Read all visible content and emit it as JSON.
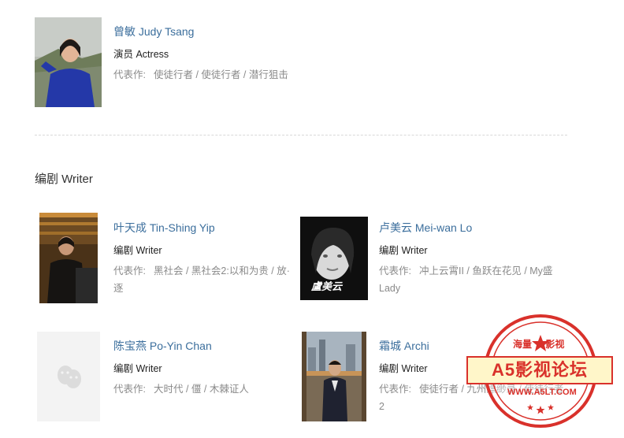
{
  "actors": [
    {
      "name": "曾敏 Judy Tsang",
      "role": "演员 Actress",
      "works_label": "代表作:",
      "works": "使徒行者 / 使徒行者 / 潜行狙击"
    }
  ],
  "writers_section": {
    "title": "编剧 Writer",
    "people": [
      {
        "name": "叶天成 Tin-Shing Yip",
        "role": "编剧 Writer",
        "works_label": "代表作:",
        "works": "黑社会 / 黑社会2:以和为贵 / 放·逐"
      },
      {
        "name": "卢美云 Mei-wan Lo",
        "role": "编剧 Writer",
        "works_label": "代表作:",
        "works": "冲上云霄II / 鱼跃在花见 / My盛 Lady",
        "photo_caption": "盧美云"
      },
      {
        "name": "陈宝燕 Po-Yin Chan",
        "role": "编剧 Writer",
        "works_label": "代表作:",
        "works": "大时代 / 僵 / 木棘证人"
      },
      {
        "name": "霜城 Archi",
        "role": "编剧 Writer",
        "works_label": "代表作:",
        "works": "使徒行者 / 九州缥缈录 / 使徒行者2"
      }
    ]
  },
  "watermark": {
    "top_text": "海量 ★ 影视",
    "main_text": "A5影视论坛",
    "url": "WWW.A5LT.COM"
  },
  "colors": {
    "link": "#3b6e9c",
    "muted": "#8a8a8a",
    "stamp_red": "#d9312b"
  },
  "icons": {
    "placeholder": "theater-masks-icon",
    "stamp_star": "star-icon"
  }
}
